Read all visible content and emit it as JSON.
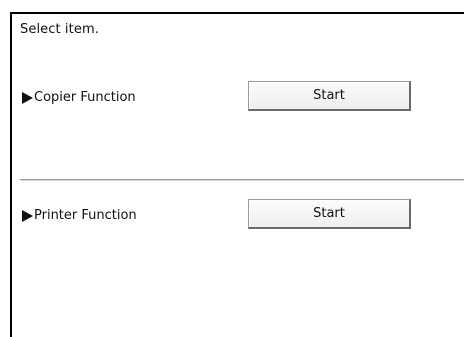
{
  "prompt": "Select item.",
  "functions": [
    {
      "label": "Copier Function",
      "button_label": "Start"
    },
    {
      "label": "Printer Function",
      "button_label": "Start"
    }
  ],
  "icons": {
    "pointer": "triangle-right-icon"
  }
}
